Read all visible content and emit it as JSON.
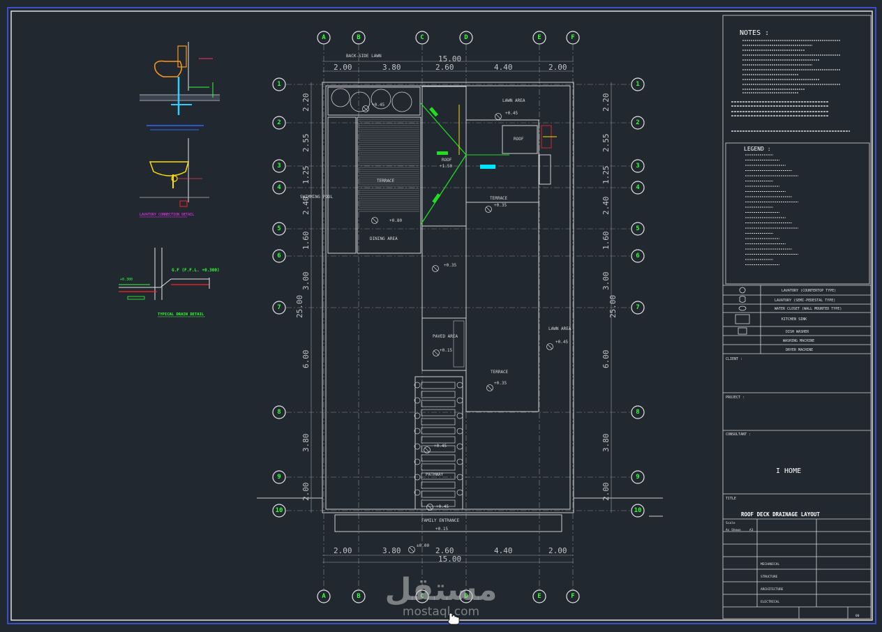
{
  "grid": {
    "columns": [
      "A",
      "B",
      "C",
      "D",
      "E",
      "F"
    ],
    "rows": [
      "1",
      "2",
      "3",
      "4",
      "5",
      "6",
      "7",
      "8",
      "9",
      "10"
    ]
  },
  "dimensions": {
    "top_total": "15.00",
    "bottom_total": "15.00",
    "top_segments": [
      "2.00",
      "3.80",
      "2.60",
      "4.40",
      "2.00"
    ],
    "bottom_segments": [
      "2.00",
      "3.80",
      "2.60",
      "4.40",
      "2.00"
    ],
    "side_total": "25.00",
    "side_segments": [
      "2.20",
      "2.55",
      "1.25",
      "2.40",
      "1.60",
      "3.00",
      "6.00",
      "3.80",
      "2.00"
    ]
  },
  "plan_labels": {
    "back_lawn": "BACK-SIDE LAWN",
    "swimming_pool": "SWIMMING POOL",
    "terrace": "TERRACE",
    "dining_area": "DINING AREA",
    "roof": "ROOF",
    "lawn_area": "LAWN AREA",
    "paved_area": "PAVED AREA",
    "pathway": "PATHWAY",
    "family_entrance": "FAMILY ENTRANCE",
    "level_045": "+0.45",
    "level_035": "+0.35",
    "level_080": "+0.80",
    "level_1150": "+1.50",
    "level_015": "+0.15",
    "level_000": "±0.00"
  },
  "details": {
    "lavatory": "LAVATORY CONNECTION DETAIL",
    "drain": "TYPICAL DRAIN DETAIL",
    "drain_note": "G.F (F.F.L. +0.300)",
    "drain_level": "+0.300"
  },
  "title_block": {
    "notes_title": "NOTES :",
    "legend_title": "LEGEND :",
    "fixtures": [
      "LAVATORY (COUNTERTOP TYPE)",
      "LAVATORY (SEMI-PEDESTAL TYPE)",
      "WATER CLOSET (WALL MOUNTED TYPE)",
      "KITCHEN SINK",
      "DISH WASHER",
      "WASHING MACHINE",
      "DRYER MACHINE"
    ],
    "client_label": "CLIENT :",
    "project_label": "PROJECT :",
    "consultant_label": "CONSULTANT :",
    "consultant_name": "I HOME",
    "title_label": "TITLE",
    "drawing_title": "ROOF DECK  DRAINAGE LAYOUT",
    "scale_label": "Scale",
    "scale_value": "As Shown",
    "sheet_size": "A3",
    "disciplines": [
      "MECHANICAL",
      "STRUCTURE",
      "ARCHITECTURE",
      "ELECTRICAL"
    ],
    "sheet_no": "00"
  },
  "watermark": {
    "arabic": "مستقل",
    "latin": "mostaql.com"
  },
  "colors": {
    "background": "#212830",
    "lines": "#d0d0d0",
    "grid_bubble_text": "#33ff33",
    "drain_green": "#22dd22",
    "cyan": "#00e5ff",
    "yellow": "#ffdd00",
    "orange": "#ff9a1a",
    "red": "#ff2222",
    "magenta": "#ff33ff",
    "frame_blue": "#3a50c8"
  }
}
